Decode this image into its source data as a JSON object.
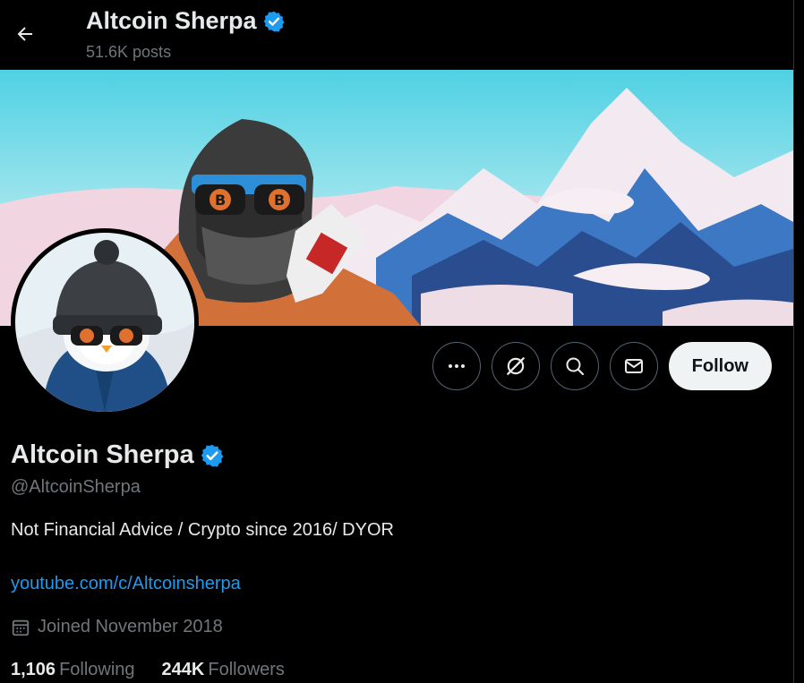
{
  "header": {
    "title": "Altcoin Sherpa",
    "post_count": "51.6K posts"
  },
  "profile": {
    "name": "Altcoin Sherpa",
    "handle": "@AltcoinSherpa",
    "bio": "Not Financial Advice / Crypto since 2016/ DYOR",
    "link": "youtube.com/c/Altcoinsherpa",
    "joined": "Joined November 2018",
    "following_count": "1,106",
    "following_label": "Following",
    "followers_count": "244K",
    "followers_label": "Followers"
  },
  "actions": {
    "follow_label": "Follow"
  },
  "colors": {
    "background": "#000000",
    "text_primary": "#e7e9ea",
    "text_secondary": "#71767b",
    "accent": "#1d9bf0",
    "verified": "#1d9bf0",
    "follow_bg": "#eff3f4"
  },
  "icons": {
    "back": "arrow-left-icon",
    "verified": "verified-badge-icon",
    "more": "more-dots-icon",
    "grok": "grok-icon",
    "search": "search-icon",
    "message": "envelope-icon",
    "calendar": "calendar-icon"
  }
}
